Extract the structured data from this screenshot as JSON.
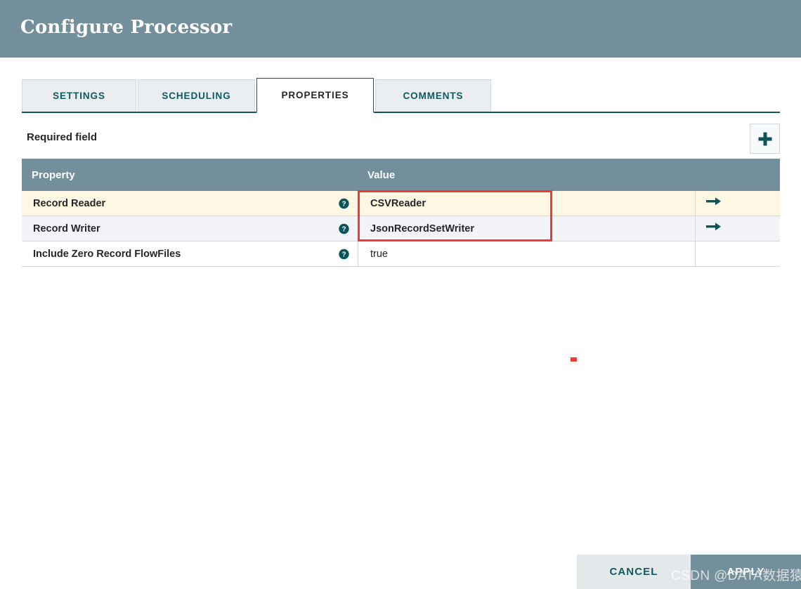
{
  "dialog": {
    "title": "Configure Processor"
  },
  "tabs": [
    {
      "id": "settings",
      "label": "SETTINGS",
      "active": false
    },
    {
      "id": "scheduling",
      "label": "SCHEDULING",
      "active": false
    },
    {
      "id": "properties",
      "label": "PROPERTIES",
      "active": true
    },
    {
      "id": "comments",
      "label": "COMMENTS",
      "active": false
    }
  ],
  "toolbar": {
    "required_field_label": "Required field",
    "add_button_icon": "plus-icon"
  },
  "table": {
    "columns": [
      "Property",
      "Value"
    ],
    "rows": [
      {
        "property": "Record Reader",
        "value": "CSVReader",
        "help_icon": "help-circle-icon",
        "goto_icon": "arrow-right-icon",
        "has_goto": true
      },
      {
        "property": "Record Writer",
        "value": "JsonRecordSetWriter",
        "help_icon": "help-circle-icon",
        "goto_icon": "arrow-right-icon",
        "has_goto": true
      },
      {
        "property": "Include Zero Record FlowFiles",
        "value": "true",
        "help_icon": "help-circle-icon",
        "goto_icon": "",
        "has_goto": false
      }
    ]
  },
  "footer": {
    "cancel_label": "CANCEL",
    "apply_label": "APPLY"
  },
  "watermark": {
    "text": "CSDN @DATA数据猿"
  },
  "colors": {
    "header_bg": "#728f9b",
    "tab_active_border": "#12575c",
    "accent_teal": "#0f5a61",
    "row_odd_bg": "#fdf7e4",
    "row_even_bg": "#f2f4f7",
    "annotation_red": "#ef3b36"
  }
}
